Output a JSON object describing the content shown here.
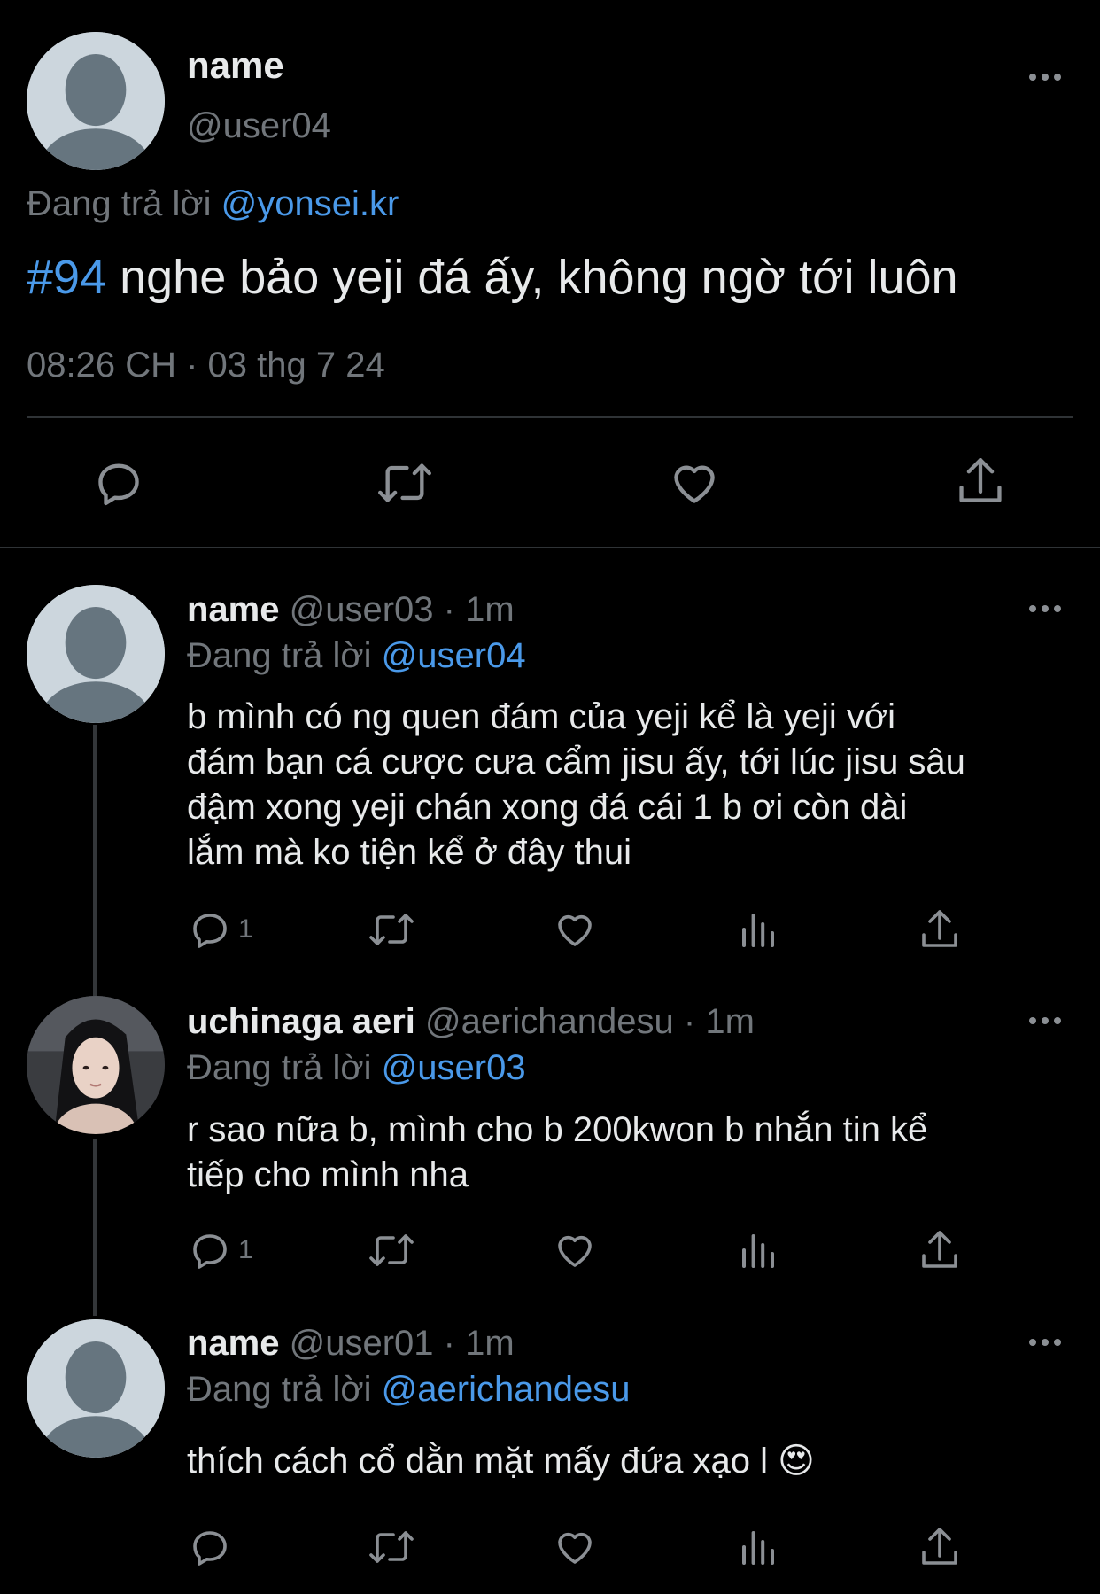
{
  "main_tweet": {
    "display_name": "name",
    "handle": "@user04",
    "replying_prefix": "Đang trả lời",
    "replying_to": "@yonsei.kr",
    "hashtag": "#94",
    "text": " nghe bảo yeji đá ấy, không ngờ tới luôn",
    "timestamp": "08:26 CH · 03 thg 7 24"
  },
  "replies": [
    {
      "display_name": "name",
      "handle": "@user03",
      "time": "· 1m",
      "replying_prefix": "Đang trả lời",
      "replying_to": "@user04",
      "lines": [
        "b mình có ng quen đám của yeji kể là yeji với",
        "đám bạn cá cược cưa cẩm jisu ấy, tới lúc jisu sâu",
        "đậm xong yeji chán xong đá cái 1 b ơi còn dài",
        "lắm mà ko tiện kể ở đây thui"
      ],
      "reply_count": "1"
    },
    {
      "display_name": "uchinaga aeri",
      "handle": "@aerichandesu",
      "time": "· 1m",
      "replying_prefix": "Đang trả lời",
      "replying_to": "@user03",
      "lines": [
        "r sao nữa b, mình cho b 200kwon b nhắn tin kể",
        "tiếp cho mình nha"
      ],
      "reply_count": "1"
    },
    {
      "display_name": "name",
      "handle": "@user01",
      "time": "· 1m",
      "replying_prefix": "Đang trả lời",
      "replying_to": "@aerichandesu",
      "lines": [
        "thích cách cổ dằn mặt mấy đứa xạo l 😍"
      ],
      "reply_count": ""
    }
  ],
  "colors": {
    "background": "#000000",
    "text": "#e7e9ea",
    "muted": "#71767b",
    "link": "#4a99e9"
  },
  "icons": [
    "reply-icon",
    "retweet-icon",
    "like-icon",
    "views-icon",
    "share-icon",
    "more-icon"
  ]
}
